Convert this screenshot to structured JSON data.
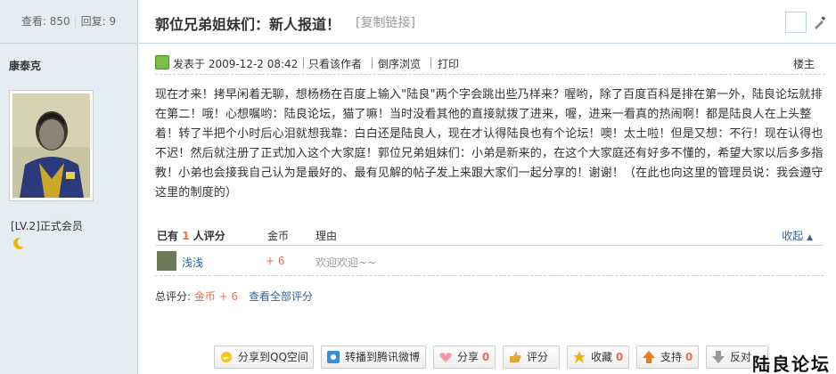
{
  "sidebar": {
    "views_label": "查看",
    "views_count": "850",
    "replies_label": "回复",
    "replies_count": "9",
    "author": "康泰克",
    "level": "[LV.2]正式会员"
  },
  "thread": {
    "title": "郭位兄弟姐妹们：新人报道！",
    "copy_link": "[复制链接]"
  },
  "post": {
    "posted_at": "发表于 2009-12-2 08:42",
    "only_author": "只看该作者",
    "reverse_view": "倒序浏览",
    "print": "打印",
    "floor": "楼主",
    "body": "现在才来！拷早闲着无聊，想杨杨在百度上输入\"陆良\"两个字会跳出些乃样来？喔哟，除了百度百科是排在第一外，陆良论坛就排在第二！哦！心想嘱哟：陆良论坛，猫了嘛！当时没看其他的直接就拨了进来，喔，进来一看真的热闹啊！都是陆良人在上头整着！转了半把个小时后心泪就想我靠：白白还是陆良人，现在才认得陆良也有个论坛！噢！太土啦！但是又想：不行！现在认得也不迟！然后就注册了正式加入这个大家庭！郭位兄弟姐妹们：小弟是新来的，在这个大家庭还有好多不懂的，希望大家以后多多指教！小弟也会接我自己认为是最好的、最有见解的帖子发上来跟大家们一起分享的！谢谢！（在此也向这里的管理员说：我会遵守这里的制度的）"
  },
  "rating": {
    "header_prefix": "已有",
    "header_count": "1",
    "header_suffix": "人评分",
    "col_gold": "金币",
    "col_reason": "理由",
    "collapse": "收起",
    "rows": [
      {
        "user": "浅浅",
        "gold": "+ 6",
        "reason": "欢迎欢迎~~"
      }
    ],
    "total_label": "总评分:",
    "total_value": "金币 + 6",
    "view_all": "查看全部评分"
  },
  "actions": {
    "share_qzone": "分享到QQ空间",
    "share_weibo": "转播到腾讯微博",
    "share": "分享",
    "share_count": "0",
    "rate": "评分",
    "favorite": "收藏",
    "favorite_count": "0",
    "support": "支持",
    "support_count": "0",
    "oppose": "反对"
  },
  "watermark": "陆良论坛",
  "icons": [
    "edit-icon",
    "post-icon",
    "moon-icon",
    "qzone-icon",
    "weibo-icon",
    "heart-icon",
    "rate-icon",
    "star-icon",
    "support-icon",
    "oppose-icon"
  ],
  "colors": {
    "sidebar_bg": "#e5edf2",
    "border": "#c2d5e3",
    "accent": "#f26c4f",
    "link": "#336699"
  }
}
